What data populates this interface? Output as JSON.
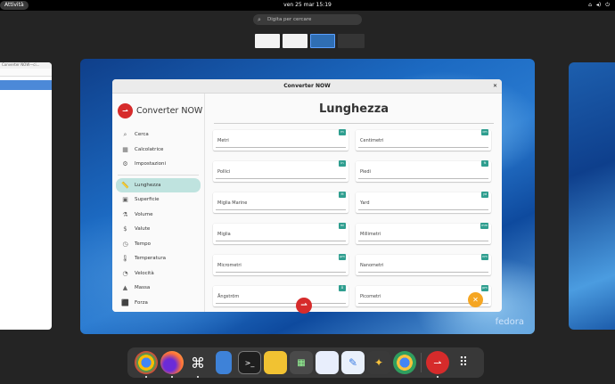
{
  "topbar": {
    "activities": "Attività",
    "clock": "ven 25 mar  15:19",
    "sys_icons": [
      "network-icon",
      "volume-icon",
      "power-icon"
    ]
  },
  "search": {
    "placeholder": "Digita per cercare"
  },
  "left_window": {
    "title": "Converter NOW—ci..."
  },
  "app": {
    "title": "Converter NOW",
    "logo_text": "Converter NOW",
    "menu_top": [
      {
        "label": "Cerca",
        "icon": "search-icon"
      },
      {
        "label": "Calcolatrice",
        "icon": "calculator-icon"
      },
      {
        "label": "Impostazioni",
        "icon": "settings-icon"
      }
    ],
    "menu_units": [
      {
        "label": "Lunghezza",
        "icon": "ruler-icon"
      },
      {
        "label": "Superficie",
        "icon": "area-icon"
      },
      {
        "label": "Volume",
        "icon": "flask-icon"
      },
      {
        "label": "Valute",
        "icon": "money-bag-icon"
      },
      {
        "label": "Tempo",
        "icon": "clock-icon"
      },
      {
        "label": "Temperatura",
        "icon": "thermometer-icon"
      },
      {
        "label": "Velocità",
        "icon": "speedometer-icon"
      },
      {
        "label": "Massa",
        "icon": "weight-icon"
      },
      {
        "label": "Forza",
        "icon": "force-icon"
      }
    ],
    "selected": "Lunghezza",
    "page_title": "Lunghezza",
    "units": [
      {
        "label": "Metri",
        "symbol": "m"
      },
      {
        "label": "Centimetri",
        "symbol": "cm"
      },
      {
        "label": "Pollici",
        "symbol": "in"
      },
      {
        "label": "Piedi",
        "symbol": "ft"
      },
      {
        "label": "Miglia Marine",
        "symbol": "M"
      },
      {
        "label": "Yard",
        "symbol": "yd"
      },
      {
        "label": "Miglia",
        "symbol": "mi"
      },
      {
        "label": "Millimetri",
        "symbol": "mm"
      },
      {
        "label": "Micrometri",
        "symbol": "µm"
      },
      {
        "label": "Nanometri",
        "symbol": "nm"
      },
      {
        "label": "Ångström",
        "symbol": "Å"
      },
      {
        "label": "Picometri",
        "symbol": "pm"
      }
    ],
    "fab_icon": "clear-icon"
  },
  "wallpaper_brand": "fedora",
  "dock": [
    "Chrome",
    "Firefox",
    "Inkscape",
    "Files",
    "Terminal",
    "Mail",
    "Calculator",
    "Notes",
    "Text Editor",
    "Toolbox",
    "Chrome Dev",
    "Converter NOW",
    "App Grid"
  ],
  "colors": {
    "accent": "#2f9e8f",
    "selection": "#bfe3df",
    "fab": "#f5a623",
    "brand": "#d62b2b"
  }
}
